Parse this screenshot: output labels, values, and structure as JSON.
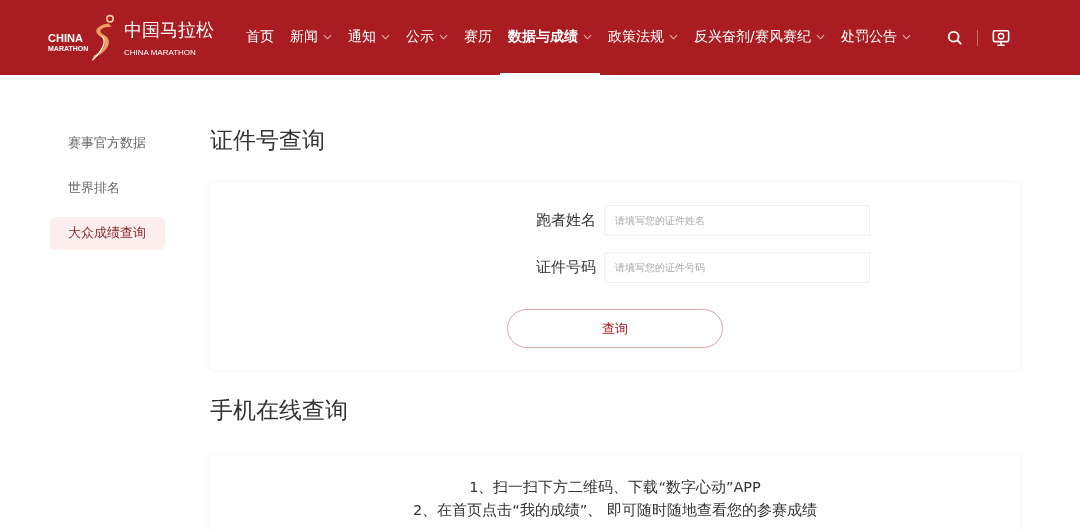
{
  "logo": {
    "mark_top": "CHINA",
    "mark_bottom": "MARATHON",
    "title": "中国马拉松",
    "subtitle": "CHINA MARATHON"
  },
  "nav": [
    {
      "label": "首页",
      "has_menu": false,
      "selected": false
    },
    {
      "label": "新闻",
      "has_menu": true,
      "selected": false
    },
    {
      "label": "通知",
      "has_menu": true,
      "selected": false
    },
    {
      "label": "公示",
      "has_menu": true,
      "selected": false
    },
    {
      "label": "赛历",
      "has_menu": false,
      "selected": false
    },
    {
      "label": "数据与成绩",
      "has_menu": true,
      "selected": true
    },
    {
      "label": "政策法规",
      "has_menu": true,
      "selected": false
    },
    {
      "label": "反兴奋剂/赛风赛纪",
      "has_menu": true,
      "selected": false
    },
    {
      "label": "处罚公告",
      "has_menu": true,
      "selected": false
    }
  ],
  "sidebar": {
    "items": [
      {
        "label": "赛事官方数据",
        "selected": false
      },
      {
        "label": "世界排名",
        "selected": false
      },
      {
        "label": "大众成绩查询",
        "selected": true
      }
    ]
  },
  "id_query": {
    "title": "证件号查询",
    "fields": [
      {
        "label": "跑者姓名",
        "placeholder": "请填写您的证件姓名"
      },
      {
        "label": "证件号码",
        "placeholder": "请填写您的证件号码"
      }
    ],
    "button": "查询"
  },
  "mobile_query": {
    "title": "手机在线查询",
    "lines": [
      "1、扫一扫下方二维码、下载“数字心动”APP",
      "2、在首页点击“我的成绩”、 即可随时随地查看您的参赛成绩"
    ]
  }
}
